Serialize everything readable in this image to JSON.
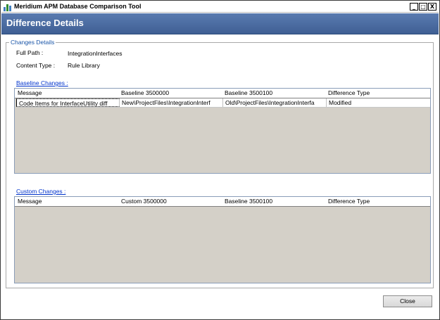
{
  "window": {
    "title": "Meridium APM Database Comparison Tool",
    "controls": {
      "minimize": "_",
      "maximize": "□",
      "close": "X"
    }
  },
  "header": {
    "title": "Difference Details"
  },
  "group": {
    "legend": "Changes Details"
  },
  "fields": {
    "full_path_label": "Full Path :",
    "full_path_value": "IntegrationInterfaces",
    "content_type_label": "Content Type :",
    "content_type_value": "Rule Library"
  },
  "baseline_changes": {
    "link": "Baseline Changes :",
    "columns": [
      "Message",
      "Baseline 3500000",
      "Baseline 3500100",
      "Difference Type"
    ],
    "rows": [
      [
        "Code Items for InterfaceUtility diff",
        "New\\ProjectFiles\\IntegrationInterf",
        "Old\\ProjectFiles\\IntegrationInterfa",
        "Modified"
      ]
    ]
  },
  "custom_changes": {
    "link": "Custom Changes :",
    "columns": [
      "Message",
      "Custom 3500000",
      "Baseline 3500100",
      "Difference Type"
    ],
    "rows": []
  },
  "buttons": {
    "close": "Close"
  },
  "colors": {
    "header_bg": "#4a6aa0",
    "link": "#0033cc",
    "legend": "#1a55a8",
    "grid_bg": "#d4d0c8"
  }
}
